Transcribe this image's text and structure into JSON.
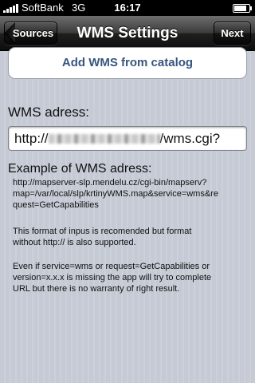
{
  "status_bar": {
    "carrier": "SoftBank",
    "network": "3G",
    "time": "16:17",
    "battery_level": 0.9
  },
  "nav": {
    "back_label": "Sources",
    "title": "WMS Settings",
    "next_label": "Next"
  },
  "catalog_button_label": "Add WMS from catalog",
  "wms_address": {
    "label": "WMS adress:",
    "value_prefix": "http://",
    "value_suffix": "/wms.cgi?"
  },
  "example": {
    "heading": "Example of WMS adress:",
    "url": "http://mapserver-slp.mendelu.cz/cgi-bin/mapserv?map=/var/local/slp/krtinyWMS.map&service=wms&request=GetCapabilities",
    "format_note": "This format of inpus is recomended but format without http:// is also supported.",
    "warning_note": "Even if service=wms or request=GetCapabilities or version=x.x.x is missing the app will try to complete URL but there is no warranty of right result."
  }
}
